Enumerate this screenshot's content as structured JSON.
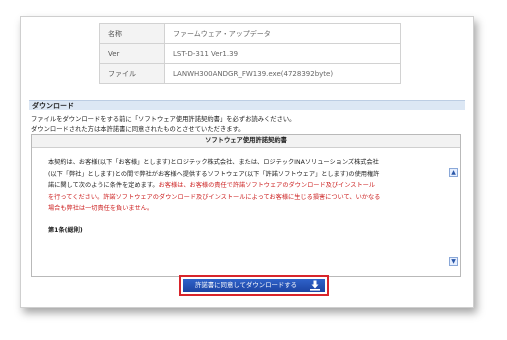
{
  "info": [
    {
      "key": "名称",
      "value": "ファームウェア・アップデータ"
    },
    {
      "key": "Ver",
      "value": "LST-D-311 Ver1.39"
    },
    {
      "key": "ファイル",
      "value": "LANWH300ANDGR_FW139.exe(4728392byte)"
    }
  ],
  "download": {
    "header": "ダウンロード",
    "note1": "ファイルをダウンロードをする前に「ソフトウェア使用許諾契約書」を必ずお読みください。",
    "note2": "ダウンロードされた方は本許諾書に同意されたものとさせていただきます。",
    "button_label": "許諾書に同意してダウンロードする",
    "button_icon": "download-icon"
  },
  "license": {
    "title": "ソフトウェア使用許諾契約書",
    "para_line1": "本契約は、お客様(以下「お客様」とします)とロジテック株式会社、または、ロジテックINAソリューションズ株式会社",
    "para_line2": "(以下「弊社」とします)との間で弊社がお客様へ提供するソフトウェア(以下「許諾ソフトウェア」とします)の使用権許",
    "para_line3_black": "諾に関して次のように条件を定めます。",
    "para_line3_red": "お客様は、お客様の責任で許諾ソフトウェアのダウンロード及びインストール",
    "para_line4_red": "を行ってください。許諾ソフトウェアのダウンロード及びインストールによってお客様に生じる損害について、いかなる",
    "para_line5_red": "場合も弊社は一切責任を負いません。",
    "section": "第1条(総則)"
  },
  "colors": {
    "header_bg": "#dce7f4",
    "button_bg": "#2f62c9",
    "button_border": "#d8242b",
    "warning_text": "#cc1f1f"
  }
}
